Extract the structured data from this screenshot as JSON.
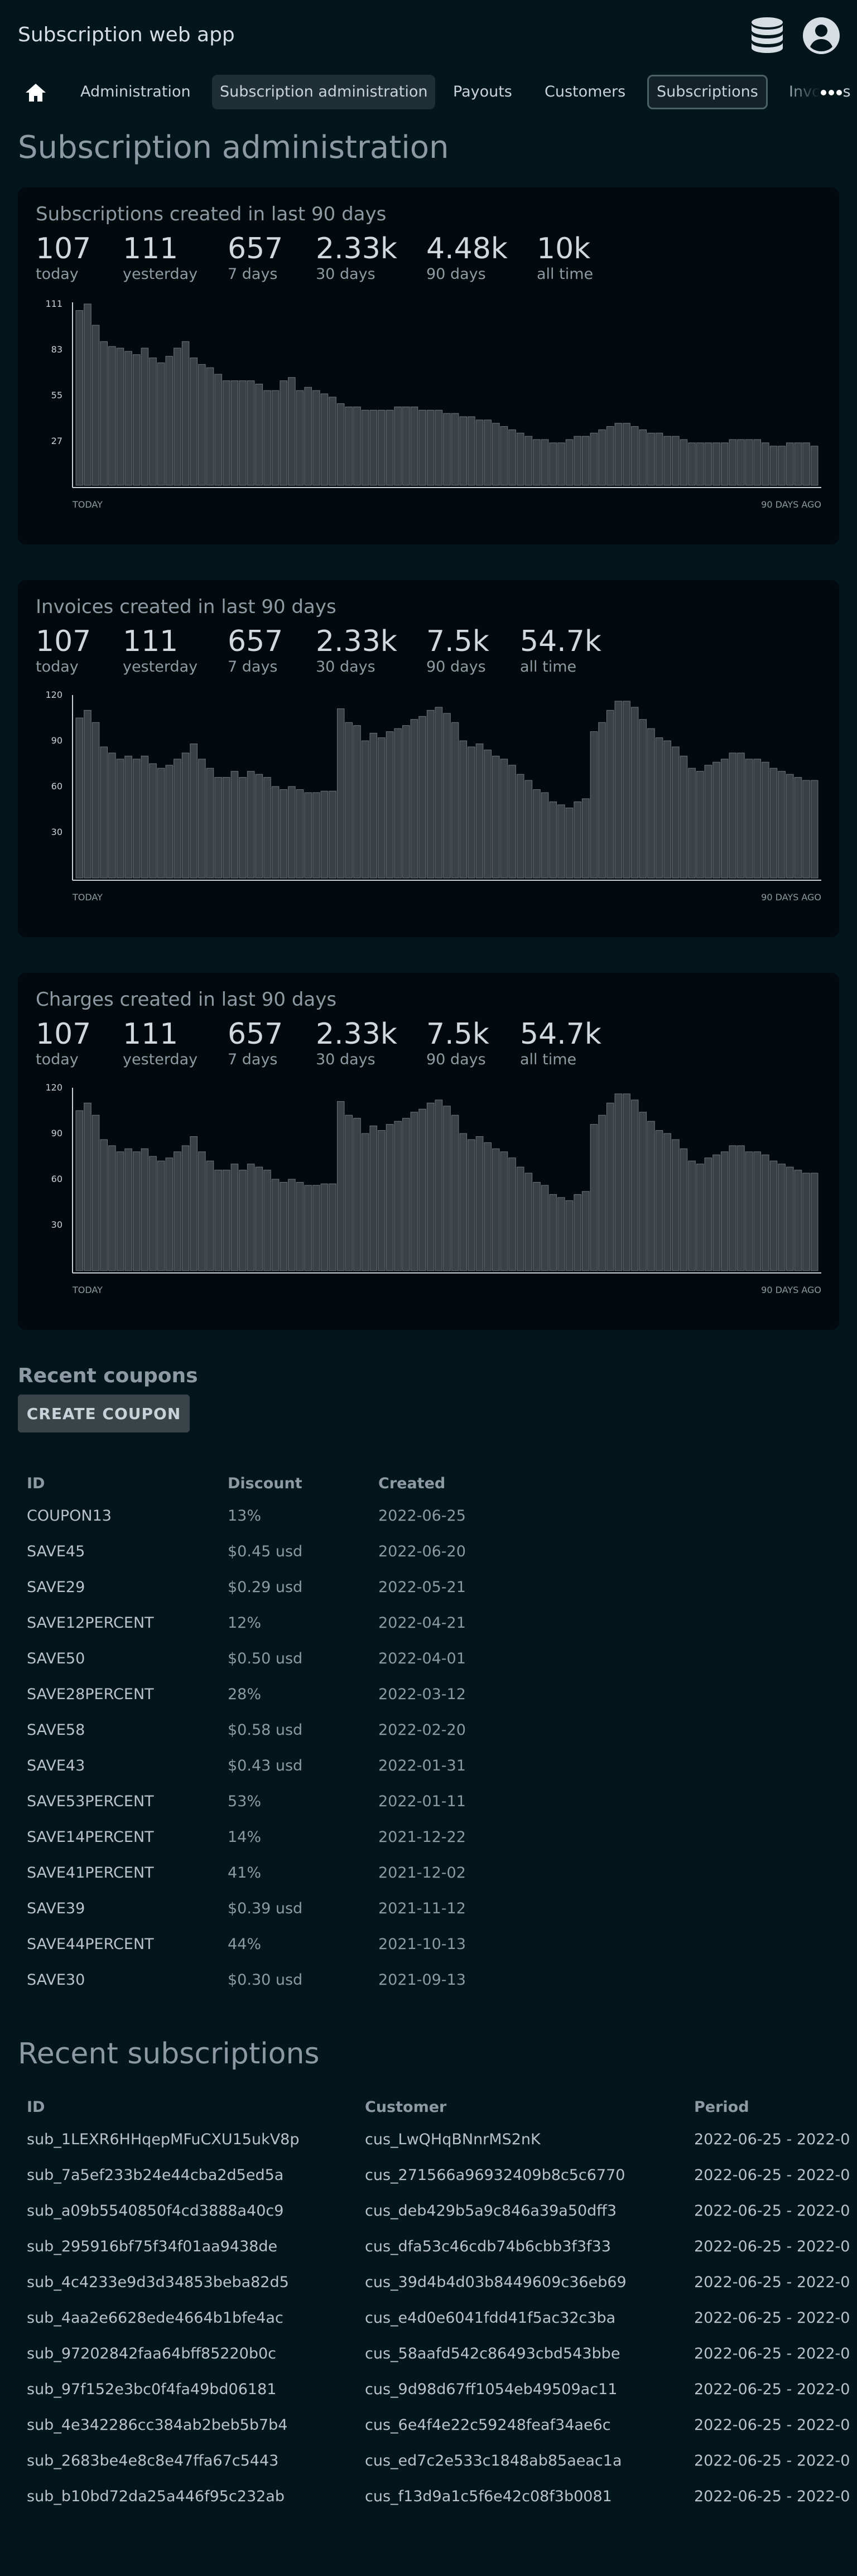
{
  "app": {
    "title": "Subscription web app"
  },
  "nav": {
    "items": [
      {
        "label": "Administration",
        "state": "normal"
      },
      {
        "label": "Subscription administration",
        "state": "active"
      },
      {
        "label": "Payouts",
        "state": "normal"
      },
      {
        "label": "Customers",
        "state": "normal"
      },
      {
        "label": "Subscriptions",
        "state": "outlined"
      },
      {
        "label": "Invoices",
        "state": "normal"
      }
    ],
    "home_icon": "home-icon",
    "more_icon": "more-horizontal-icon"
  },
  "page": {
    "title": "Subscription administration"
  },
  "cards": [
    {
      "title": "Subscriptions created in last 90 days",
      "stats": [
        {
          "value": "107",
          "label": "today"
        },
        {
          "value": "111",
          "label": "yesterday"
        },
        {
          "value": "657",
          "label": "7 days"
        },
        {
          "value": "2.33k",
          "label": "30 days"
        },
        {
          "value": "4.48k",
          "label": "90 days"
        },
        {
          "value": "10k",
          "label": "all time"
        }
      ],
      "axis_left": "TODAY",
      "axis_right": "90 DAYS AGO"
    },
    {
      "title": "Invoices created in last 90 days",
      "stats": [
        {
          "value": "107",
          "label": "today"
        },
        {
          "value": "111",
          "label": "yesterday"
        },
        {
          "value": "657",
          "label": "7 days"
        },
        {
          "value": "2.33k",
          "label": "30 days"
        },
        {
          "value": "7.5k",
          "label": "90 days"
        },
        {
          "value": "54.7k",
          "label": "all time"
        }
      ],
      "axis_left": "TODAY",
      "axis_right": "90 DAYS AGO"
    },
    {
      "title": "Charges created in last 90 days",
      "stats": [
        {
          "value": "107",
          "label": "today"
        },
        {
          "value": "111",
          "label": "yesterday"
        },
        {
          "value": "657",
          "label": "7 days"
        },
        {
          "value": "2.33k",
          "label": "30 days"
        },
        {
          "value": "7.5k",
          "label": "90 days"
        },
        {
          "value": "54.7k",
          "label": "all time"
        }
      ],
      "axis_left": "TODAY",
      "axis_right": "90 DAYS AGO"
    }
  ],
  "chart_data": [
    {
      "type": "bar",
      "yticks": [
        27,
        55,
        83,
        111
      ],
      "ylim": [
        0,
        112
      ],
      "values": [
        107,
        111,
        98,
        88,
        85,
        84,
        82,
        80,
        84,
        78,
        75,
        79,
        84,
        88,
        78,
        74,
        72,
        68,
        64,
        64,
        64,
        64,
        62,
        58,
        58,
        64,
        66,
        58,
        60,
        58,
        56,
        54,
        50,
        48,
        48,
        46,
        46,
        46,
        46,
        48,
        48,
        48,
        46,
        46,
        46,
        44,
        44,
        42,
        42,
        40,
        40,
        38,
        36,
        34,
        32,
        30,
        28,
        28,
        26,
        26,
        28,
        30,
        30,
        32,
        34,
        36,
        38,
        38,
        36,
        34,
        32,
        32,
        30,
        30,
        28,
        26,
        26,
        26,
        26,
        26,
        28,
        28,
        28,
        28,
        26,
        24,
        24,
        26,
        26,
        26,
        24
      ]
    },
    {
      "type": "bar",
      "yticks": [
        30,
        60,
        90,
        120
      ],
      "ylim": [
        0,
        120
      ],
      "values": [
        105,
        110,
        102,
        86,
        82,
        78,
        80,
        78,
        80,
        75,
        72,
        74,
        78,
        82,
        88,
        78,
        72,
        66,
        66,
        70,
        66,
        70,
        68,
        66,
        60,
        58,
        60,
        58,
        56,
        56,
        57,
        57,
        111,
        102,
        100,
        90,
        95,
        92,
        96,
        98,
        100,
        104,
        106,
        110,
        112,
        108,
        102,
        90,
        86,
        88,
        84,
        80,
        78,
        74,
        68,
        64,
        58,
        56,
        50,
        48,
        46,
        50,
        52,
        96,
        102,
        110,
        116,
        116,
        112,
        104,
        98,
        92,
        90,
        86,
        80,
        72,
        70,
        74,
        76,
        78,
        82,
        82,
        78,
        78,
        76,
        72,
        70,
        68,
        66,
        64,
        64
      ]
    },
    {
      "type": "bar",
      "yticks": [
        30,
        60,
        90,
        120
      ],
      "ylim": [
        0,
        120
      ],
      "values": [
        105,
        110,
        102,
        86,
        82,
        78,
        80,
        78,
        80,
        75,
        72,
        74,
        78,
        82,
        88,
        78,
        72,
        66,
        66,
        70,
        66,
        70,
        68,
        66,
        60,
        58,
        60,
        58,
        56,
        56,
        57,
        57,
        111,
        102,
        100,
        90,
        95,
        92,
        96,
        98,
        100,
        104,
        106,
        110,
        112,
        108,
        102,
        90,
        86,
        88,
        84,
        80,
        78,
        74,
        68,
        64,
        58,
        56,
        50,
        48,
        46,
        50,
        52,
        96,
        102,
        110,
        116,
        116,
        112,
        104,
        98,
        92,
        90,
        86,
        80,
        72,
        70,
        74,
        76,
        78,
        82,
        82,
        78,
        78,
        76,
        72,
        70,
        68,
        66,
        64,
        64
      ]
    }
  ],
  "coupons": {
    "title": "Recent coupons",
    "create_label": "CREATE COUPON",
    "headers": {
      "id": "ID",
      "discount": "Discount",
      "created": "Created"
    },
    "rows": [
      {
        "id": "COUPON13",
        "discount": "13%",
        "created": "2022-06-25"
      },
      {
        "id": "SAVE45",
        "discount": "$0.45 usd",
        "created": "2022-06-20"
      },
      {
        "id": "SAVE29",
        "discount": "$0.29 usd",
        "created": "2022-05-21"
      },
      {
        "id": "SAVE12PERCENT",
        "discount": "12%",
        "created": "2022-04-21"
      },
      {
        "id": "SAVE50",
        "discount": "$0.50 usd",
        "created": "2022-04-01"
      },
      {
        "id": "SAVE28PERCENT",
        "discount": "28%",
        "created": "2022-03-12"
      },
      {
        "id": "SAVE58",
        "discount": "$0.58 usd",
        "created": "2022-02-20"
      },
      {
        "id": "SAVE43",
        "discount": "$0.43 usd",
        "created": "2022-01-31"
      },
      {
        "id": "SAVE53PERCENT",
        "discount": "53%",
        "created": "2022-01-11"
      },
      {
        "id": "SAVE14PERCENT",
        "discount": "14%",
        "created": "2021-12-22"
      },
      {
        "id": "SAVE41PERCENT",
        "discount": "41%",
        "created": "2021-12-02"
      },
      {
        "id": "SAVE39",
        "discount": "$0.39 usd",
        "created": "2021-11-12"
      },
      {
        "id": "SAVE44PERCENT",
        "discount": "44%",
        "created": "2021-10-13"
      },
      {
        "id": "SAVE30",
        "discount": "$0.30 usd",
        "created": "2021-09-13"
      }
    ]
  },
  "subscriptions": {
    "title": "Recent subscriptions",
    "headers": {
      "id": "ID",
      "customer": "Customer",
      "period": "Period"
    },
    "rows": [
      {
        "id": "sub_1LEXR6HHqepMFuCXU15ukV8p",
        "customer": "cus_LwQHqBNnrMS2nK",
        "period": "2022-06-25 - 2022-0"
      },
      {
        "id": "sub_7a5ef233b24e44cba2d5ed5a",
        "customer": "cus_271566a96932409b8c5c6770",
        "period": "2022-06-25 - 2022-0"
      },
      {
        "id": "sub_a09b5540850f4cd3888a40c9",
        "customer": "cus_deb429b5a9c846a39a50dff3",
        "period": "2022-06-25 - 2022-0"
      },
      {
        "id": "sub_295916bf75f34f01aa9438de",
        "customer": "cus_dfa53c46cdb74b6cbb3f3f33",
        "period": "2022-06-25 - 2022-0"
      },
      {
        "id": "sub_4c4233e9d3d34853beba82d5",
        "customer": "cus_39d4b4d03b8449609c36eb69",
        "period": "2022-06-25 - 2022-0"
      },
      {
        "id": "sub_4aa2e6628ede4664b1bfe4ac",
        "customer": "cus_e4d0e6041fdd41f5ac32c3ba",
        "period": "2022-06-25 - 2022-0"
      },
      {
        "id": "sub_97202842faa64bff85220b0c",
        "customer": "cus_58aafd542c86493cbd543bbe",
        "period": "2022-06-25 - 2022-0"
      },
      {
        "id": "sub_97f152e3bc0f4fa49bd06181",
        "customer": "cus_9d98d67ff1054eb49509ac11",
        "period": "2022-06-25 - 2022-0"
      },
      {
        "id": "sub_4e342286cc384ab2beb5b7b4",
        "customer": "cus_6e4f4e22c59248feaf34ae6c",
        "period": "2022-06-25 - 2022-0"
      },
      {
        "id": "sub_2683be4e8c8e47ffa67c5443",
        "customer": "cus_ed7c2e533c1848ab85aeac1a",
        "period": "2022-06-25 - 2022-0"
      },
      {
        "id": "sub_b10bd72da25a446f95c232ab",
        "customer": "cus_f13d9a1c5f6e42c08f3b0081",
        "period": "2022-06-25 - 2022-0"
      }
    ]
  },
  "colors": {
    "background": "#03161b",
    "card": "#020a0d",
    "bar": "#3b4146",
    "bar_stroke": "#6e757b"
  }
}
